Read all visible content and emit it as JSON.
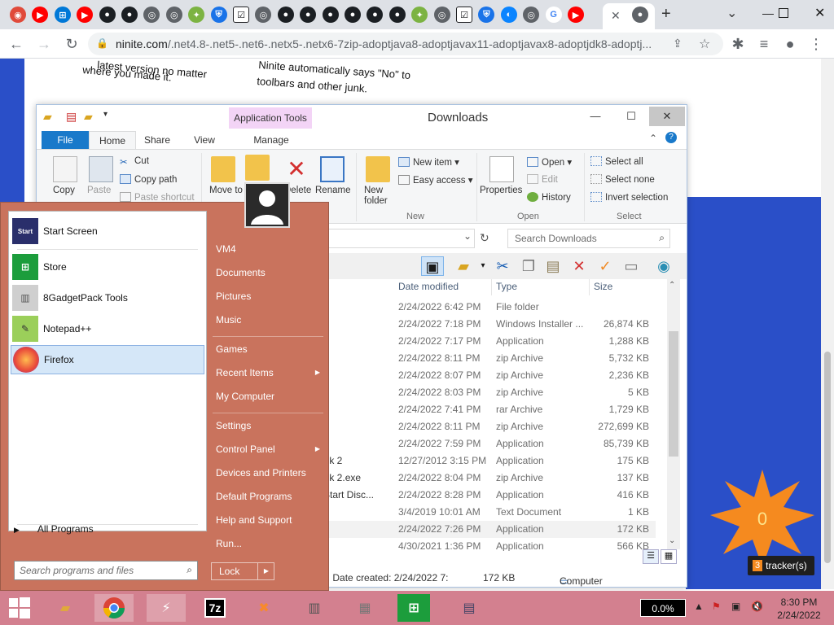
{
  "browser": {
    "tabs": {
      "favicons": [
        {
          "name": "chrome",
          "color": "#e04a3a"
        },
        {
          "name": "youtube",
          "color": "#ff0000"
        },
        {
          "name": "windows",
          "color": "#0078d7"
        },
        {
          "name": "youtube",
          "color": "#ff0000"
        },
        {
          "name": "github",
          "color": "#1b1f23"
        },
        {
          "name": "github",
          "color": "#1b1f23"
        },
        {
          "name": "globe",
          "color": "#5f6368"
        },
        {
          "name": "globe",
          "color": "#5f6368"
        },
        {
          "name": "ninite",
          "color": "#7cb342"
        },
        {
          "name": "shield",
          "color": "#1a73e8"
        },
        {
          "name": "check",
          "color": "#202124"
        },
        {
          "name": "globe",
          "color": "#5f6368"
        },
        {
          "name": "github",
          "color": "#1b1f23"
        },
        {
          "name": "github",
          "color": "#1b1f23"
        },
        {
          "name": "github",
          "color": "#1b1f23"
        },
        {
          "name": "github",
          "color": "#1b1f23"
        },
        {
          "name": "github",
          "color": "#1b1f23"
        },
        {
          "name": "github",
          "color": "#1b1f23"
        },
        {
          "name": "ninite",
          "color": "#7cb342"
        },
        {
          "name": "globe",
          "color": "#5f6368"
        },
        {
          "name": "check",
          "color": "#202124"
        },
        {
          "name": "shield",
          "color": "#1a73e8"
        },
        {
          "name": "edge",
          "color": "#0a84ff"
        },
        {
          "name": "globe",
          "color": "#5f6368"
        },
        {
          "name": "google",
          "color": "#4285f4"
        },
        {
          "name": "youtube",
          "color": "#ff0000"
        }
      ],
      "active_close": "✕",
      "after_close_favicon": "globe",
      "new_tab": "+",
      "chevron": "⌄"
    },
    "url_host": "ninite.com",
    "url_path": "/.net4.8-.net5-.net6-.netx5-.netx6-7zip-adoptjava8-adoptjavax11-adoptjavax8-adoptjdk8-adoptj..."
  },
  "webpage": {
    "text1": "where you made it.",
    "text1b": "latest version no matter",
    "text2": "Ninite automatically says \"No\" to",
    "text3": "toolbars and other junk.",
    "tracker_count": "3",
    "tracker_label": "tracker(s)",
    "star_value": "0"
  },
  "explorer": {
    "title": "Downloads",
    "context_tab": "Application Tools",
    "ribbon_tabs": [
      "File",
      "Home",
      "Share",
      "View",
      "Manage"
    ],
    "clipboard": {
      "copy": "Copy",
      "paste": "Paste",
      "cut": "Cut",
      "copy_path": "Copy path",
      "paste_shortcut": "Paste shortcut"
    },
    "organize": {
      "move_to": "Move to",
      "delete": "Delete",
      "rename": "Rename"
    },
    "new_group": {
      "new_folder": "New folder",
      "new_item": "New item",
      "easy_access": "Easy access",
      "label": "New"
    },
    "open_group": {
      "properties": "Properties",
      "open": "Open",
      "edit": "Edit",
      "history": "History",
      "label": "Open"
    },
    "select_group": {
      "select_all": "Select all",
      "select_none": "Select none",
      "invert": "Invert selection",
      "label": "Select"
    },
    "search_placeholder": "Search Downloads",
    "columns": [
      "Date modified",
      "Type",
      "Size"
    ],
    "rows": [
      {
        "date": "2/24/2022 6:42 PM",
        "type": "File folder",
        "size": ""
      },
      {
        "date": "2/24/2022 7:18 PM",
        "type": "Windows Installer ...",
        "size": "26,874 KB"
      },
      {
        "date": "2/24/2022 7:17 PM",
        "type": "Application",
        "size": "1,288 KB"
      },
      {
        "date": "2/24/2022 8:11 PM",
        "type": "zip Archive",
        "size": "5,732 KB"
      },
      {
        "date": "2/24/2022 8:07 PM",
        "type": "zip Archive",
        "size": "2,236 KB"
      },
      {
        "date": "2/24/2022 8:03 PM",
        "type": "zip Archive",
        "size": "5 KB"
      },
      {
        "date": "2/24/2022 7:41 PM",
        "type": "rar Archive",
        "size": "1,729 KB"
      },
      {
        "date": "2/24/2022 8:11 PM",
        "type": "zip Archive",
        "size": "272,699 KB"
      },
      {
        "date": "2/24/2022 7:59 PM",
        "type": "Application",
        "size": "85,739 KB"
      },
      {
        "date": "12/27/2012 3:15 PM",
        "type": "Application",
        "size": "175 KB"
      },
      {
        "date": "2/24/2022 8:04 PM",
        "type": "zip Archive",
        "size": "137 KB"
      },
      {
        "date": "2/24/2022 8:28 PM",
        "type": "Application",
        "size": "416 KB"
      },
      {
        "date": "3/4/2019 10:01 AM",
        "type": "Text Document",
        "size": "1 KB"
      },
      {
        "date": "2/24/2022 7:26 PM",
        "type": "Application",
        "size": "172 KB"
      },
      {
        "date": "4/30/2021 1:36 PM",
        "type": "Application",
        "size": "566 KB"
      }
    ],
    "partial_names": {
      "r5": "...pack 2",
      "r6": "...pack 2.exe",
      "r4": "...ic Start Disc..."
    },
    "status_left": "n: 0.14.1.0, Date created: 2/24/2022 7:",
    "status_size": "172 KB",
    "status_computer": "Computer"
  },
  "startmenu": {
    "pinned": [
      {
        "label": "Start Screen",
        "icon": "start-screen-icon"
      },
      {
        "label": "Store",
        "icon": "store-icon"
      },
      {
        "label": "8GadgetPack Tools",
        "icon": "gadgetpack-icon"
      },
      {
        "label": "Notepad++",
        "icon": "notepad-icon"
      },
      {
        "label": "Firefox",
        "icon": "firefox-icon"
      }
    ],
    "all_programs": "All Programs",
    "search_placeholder": "Search programs and files",
    "right": [
      {
        "label": "VM4",
        "arrow": ""
      },
      {
        "label": "Documents",
        "arrow": ""
      },
      {
        "label": "Pictures",
        "arrow": ""
      },
      {
        "label": "Music",
        "arrow": ""
      },
      {
        "label": "Games",
        "arrow": ""
      },
      {
        "label": "Recent Items",
        "arrow": "▶"
      },
      {
        "label": "My Computer",
        "arrow": ""
      },
      {
        "label": "Settings",
        "arrow": ""
      },
      {
        "label": "Control Panel",
        "arrow": "▶"
      },
      {
        "label": "Devices and Printers",
        "arrow": ""
      },
      {
        "label": "Default Programs",
        "arrow": ""
      },
      {
        "label": "Help and Support",
        "arrow": ""
      },
      {
        "label": "Run...",
        "arrow": ""
      }
    ],
    "lock": "Lock"
  },
  "taskbar": {
    "cpu": "0.0%",
    "time": "8:30 PM",
    "date": "2/24/2022",
    "apps": [
      "explorer",
      "chrome",
      "winamp",
      "7zip",
      "xampp",
      "archive",
      "firewall",
      "store",
      "monitor"
    ]
  }
}
